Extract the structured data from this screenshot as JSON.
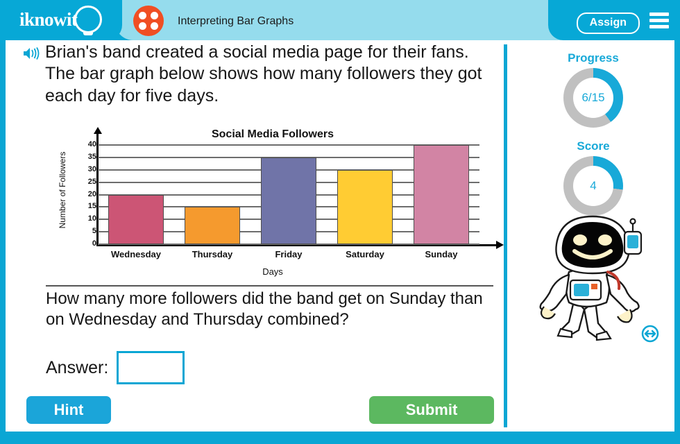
{
  "header": {
    "logo_text": "iknowit",
    "topic_title": "Interpreting Bar Graphs",
    "assign_label": "Assign",
    "menu_icon": "hamburger-menu-icon",
    "dice_icon": "red-dice-icon"
  },
  "lesson": {
    "speaker_icon": "speaker-audio-icon",
    "prompt": "Brian's band created a social media page for their fans. The bar graph below shows how many followers they got each day for five days.",
    "question": "How many more followers did the band get on Sunday than on Wednesday and Thursday combined?",
    "answer_label": "Answer:",
    "answer_value": "",
    "answer_placeholder": "",
    "hint_label": "Hint",
    "submit_label": "Submit"
  },
  "sidebar": {
    "progress_label": "Progress",
    "progress_value": "6/15",
    "progress_percent": 40,
    "score_label": "Score",
    "score_value": "4",
    "score_percent": 27,
    "mascot": "astronaut-mascot",
    "expand_icon": "expand-arrows-icon",
    "accent_color": "#18a9d8",
    "track_color": "#c0c0c0"
  },
  "chart_data": {
    "type": "bar",
    "title": "Social Media Followers",
    "xlabel": "Days",
    "ylabel": "Number of Followers",
    "categories": [
      "Wednesday",
      "Thursday",
      "Friday",
      "Saturday",
      "Sunday"
    ],
    "values": [
      20,
      15,
      35,
      30,
      40
    ],
    "colors": [
      "#cc5575",
      "#f59a2e",
      "#7074a8",
      "#ffcc33",
      "#d284a4"
    ],
    "ylim": [
      0,
      40
    ],
    "yticks": [
      40,
      35,
      30,
      25,
      20,
      15,
      10,
      5,
      0
    ],
    "grid": true,
    "legend": "none"
  },
  "theme": {
    "frame_blue": "#0aa6d4",
    "header_light": "#95dced",
    "submit_green": "#5cb860",
    "hint_blue": "#1ba5d9"
  }
}
